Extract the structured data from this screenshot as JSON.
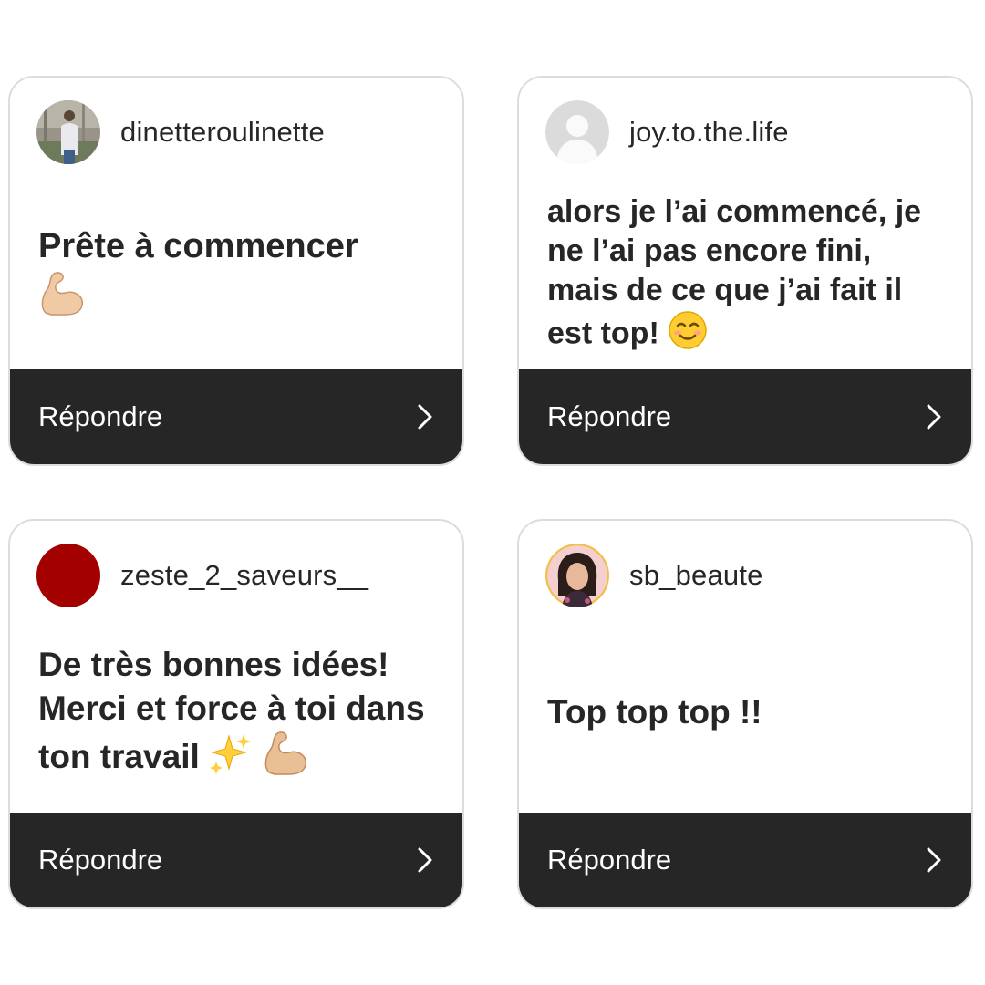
{
  "cards": [
    {
      "username": "dinetteroulinette",
      "message": "Prête à commencer",
      "emojis": [
        "flexed-biceps"
      ],
      "reply_label": "Répondre"
    },
    {
      "username": "joy.to.the.life",
      "message": "alors je l’ai commencé, je ne l’ai pas encore fini, mais de ce que j’ai fait il est top!",
      "emojis": [
        "smiling-face"
      ],
      "reply_label": "Répondre"
    },
    {
      "username": "zeste_2_saveurs__",
      "message": "De très bonnes idées! Merci et force à toi dans ton travail",
      "emojis": [
        "sparkles",
        "flexed-biceps"
      ],
      "reply_label": "Répondre"
    },
    {
      "username": "sb_beaute",
      "message": "Top top top !!",
      "emojis": [],
      "reply_label": "Répondre"
    }
  ],
  "colors": {
    "footer_bg": "#262626",
    "text": "#262626",
    "border": "#dcdcdc",
    "avatar_red": "#a30000"
  }
}
